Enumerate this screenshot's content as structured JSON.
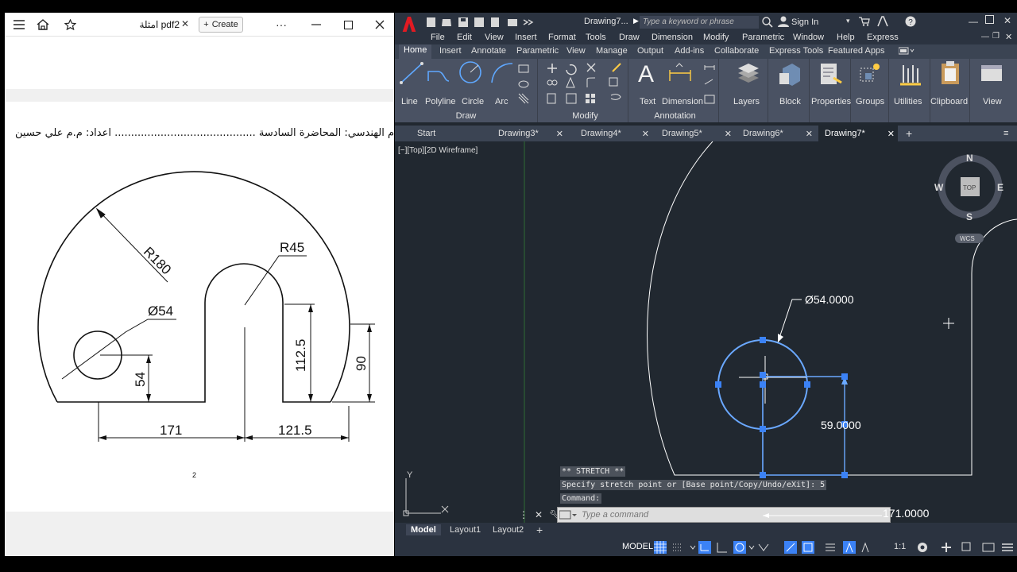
{
  "pdf": {
    "tab_title": "امثلة pdf2",
    "create_label": "Create",
    "more_label": "···",
    "header_text": "م الهندسي: المحاضرة السادسة ........................................... اعداد: م.م علي حسين",
    "page_number": "2",
    "drawing": {
      "r180": "R180",
      "r45": "R45",
      "d54": "Ø54",
      "d54_v": "54",
      "d1125": "112.5",
      "d90": "90",
      "d171": "171",
      "d1215": "121.5"
    }
  },
  "acad": {
    "title": "Drawing7...",
    "search_placeholder": "Type a keyword or phrase",
    "sign_in": "Sign In",
    "menu": [
      "File",
      "Edit",
      "View",
      "Insert",
      "Format",
      "Tools",
      "Draw",
      "Dimension",
      "Modify",
      "Parametric",
      "Window",
      "Help",
      "Express"
    ],
    "ribbon_tabs": [
      "Home",
      "Insert",
      "Annotate",
      "Parametric",
      "View",
      "Manage",
      "Output",
      "Add-ins",
      "Collaborate",
      "Express Tools",
      "Featured Apps"
    ],
    "draw_tools": [
      "Line",
      "Polyline",
      "Circle",
      "Arc"
    ],
    "annotation_tools": [
      "Text",
      "Dimension"
    ],
    "big_tools": [
      "Layers",
      "Block",
      "Properties",
      "Groups",
      "Utilities",
      "Clipboard",
      "View"
    ],
    "panels": [
      "Draw",
      "Modify",
      "Annotation"
    ],
    "doc_tabs": [
      "Start",
      "Drawing3*",
      "Drawing4*",
      "Drawing5*",
      "Drawing6*",
      "Drawing7*"
    ],
    "viewport_label": "[−][Top][2D Wireframe]",
    "viewcube": {
      "n": "N",
      "s": "S",
      "e": "E",
      "w": "W",
      "top": "TOP",
      "wcs": "WCS"
    },
    "dim_diameter": "Ø54.0000",
    "dim_vertical": "59.0000",
    "dim_horizontal": "171.0000",
    "ucs_y": "Y",
    "cmd_lines": [
      "** STRETCH **",
      "Specify stretch point or [Base point/Copy/Undo/eXit]: 5",
      "Command:"
    ],
    "cmd_placeholder": "Type a command",
    "layout_tabs": [
      "Model",
      "Layout1",
      "Layout2"
    ],
    "status_model": "MODEL",
    "status_scale": "1:1"
  }
}
